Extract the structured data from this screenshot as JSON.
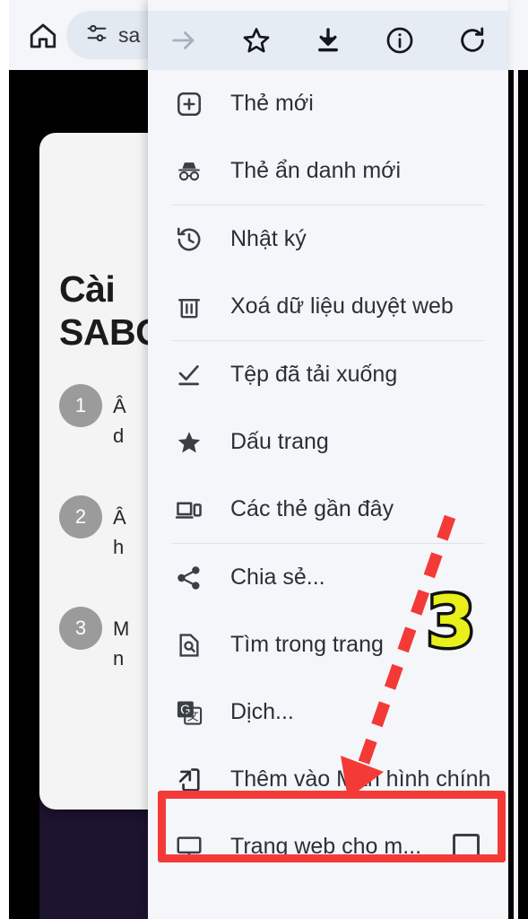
{
  "toolbar": {
    "home_icon": "home-icon",
    "tune_icon": "tune-sliders-icon",
    "url_text": "sa"
  },
  "menu": {
    "header_icons": [
      {
        "name": "forward-arrow-icon",
        "label": "Tiến"
      },
      {
        "name": "star-outline-icon",
        "label": "Dấu trang"
      },
      {
        "name": "download-icon",
        "label": "Tải xuống"
      },
      {
        "name": "info-circle-icon",
        "label": "Thông tin trang"
      },
      {
        "name": "reload-icon",
        "label": "Tải lại"
      }
    ],
    "items": [
      {
        "label": "Thẻ mới",
        "icon": "new-tab-plus-icon",
        "separator_after": false
      },
      {
        "label": "Thẻ ẩn danh mới",
        "icon": "incognito-icon",
        "separator_after": true
      },
      {
        "label": "Nhật ký",
        "icon": "history-icon",
        "separator_after": false
      },
      {
        "label": "Xoá dữ liệu duyệt web",
        "icon": "trash-icon",
        "separator_after": true
      },
      {
        "label": "Tệp đã tải xuống",
        "icon": "downloads-check-icon",
        "separator_after": false
      },
      {
        "label": "Dấu trang",
        "icon": "star-filled-icon",
        "separator_after": false
      },
      {
        "label": "Các thẻ gần đây",
        "icon": "recent-tabs-icon",
        "separator_after": true
      },
      {
        "label": "Chia sẻ...",
        "icon": "share-icon",
        "separator_after": false
      },
      {
        "label": "Tìm trong trang",
        "icon": "find-in-page-icon",
        "separator_after": false
      },
      {
        "label": "Dịch...",
        "icon": "translate-icon",
        "separator_after": false
      },
      {
        "label": "Thêm vào Màn hình chính",
        "icon": "add-to-home-screen-icon",
        "separator_after": false,
        "highlighted": true
      },
      {
        "label": "Trang web cho m...",
        "icon": "desktop-monitor-icon",
        "separator_after": false,
        "checkbox": false
      }
    ]
  },
  "background_page": {
    "title_line1": "Cài",
    "title_line2": "SABO",
    "steps": [
      {
        "number": "1",
        "line1": "Â",
        "line2": "d"
      },
      {
        "number": "2",
        "line1": "Â",
        "line2": "h"
      },
      {
        "number": "3",
        "line1": "M",
        "line2": "n"
      }
    ]
  },
  "annotations": {
    "step_badge": "3",
    "badge_color": "#e8ef1b",
    "highlight_color": "#f43a37",
    "arrow_color": "#f43a37"
  }
}
